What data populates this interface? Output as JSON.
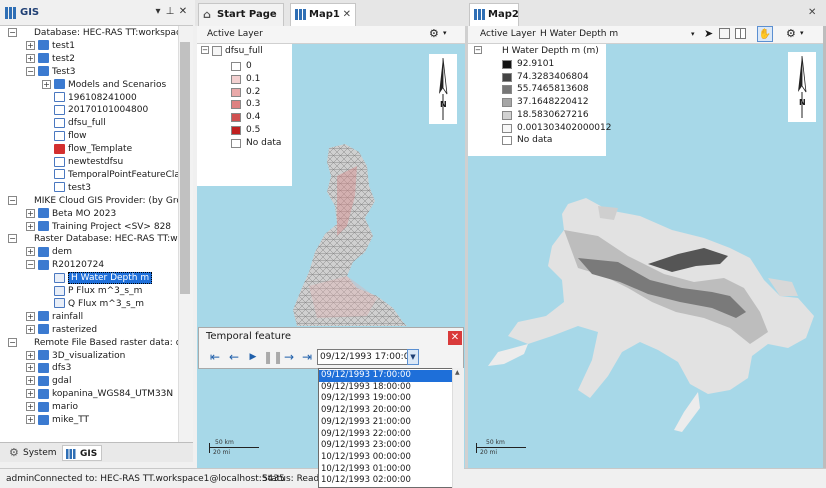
{
  "gis_panel": {
    "title": "GIS",
    "pin_icon": "pin-icon",
    "close_icon": "close-icon",
    "tree": [
      {
        "label": "Database: HEC-RAS TT:workspac•",
        "icon": "database",
        "level": 0,
        "expander": "-"
      },
      {
        "label": "test1",
        "icon": "folder",
        "level": 1,
        "expander": "+"
      },
      {
        "label": "test2",
        "icon": "folder",
        "level": 1,
        "expander": "+"
      },
      {
        "label": "Test3",
        "icon": "folder",
        "level": 1,
        "expander": "-"
      },
      {
        "label": "Models and Scenarios",
        "icon": "folder",
        "level": 2,
        "expander": "+"
      },
      {
        "label": "196108241000",
        "icon": "layer",
        "level": 2,
        "expander": ""
      },
      {
        "label": "20170101004800",
        "icon": "layer",
        "level": 2,
        "expander": ""
      },
      {
        "label": "dfsu_full",
        "icon": "layer",
        "level": 2,
        "expander": ""
      },
      {
        "label": "flow",
        "icon": "layer",
        "level": 2,
        "expander": ""
      },
      {
        "label": "flow_Template",
        "icon": "red",
        "level": 2,
        "expander": ""
      },
      {
        "label": "newtestdfsu",
        "icon": "layer",
        "level": 2,
        "expander": ""
      },
      {
        "label": "TemporalPointFeatureCla",
        "icon": "layer",
        "level": 2,
        "expander": ""
      },
      {
        "label": "test3",
        "icon": "layer",
        "level": 2,
        "expander": ""
      },
      {
        "label": "MIKE Cloud GIS Provider:  (by Gro",
        "icon": "database",
        "level": 0,
        "expander": "-"
      },
      {
        "label": "Beta MO 2023",
        "icon": "folder",
        "level": 1,
        "expander": "+"
      },
      {
        "label": "Training Project <SV> 828",
        "icon": "folder",
        "level": 1,
        "expander": "+"
      },
      {
        "label": "Raster Database: HEC-RAS TT:wo",
        "icon": "database",
        "level": 0,
        "expander": "-"
      },
      {
        "label": "dem",
        "icon": "folder",
        "level": 1,
        "expander": "+"
      },
      {
        "label": "R20120724",
        "icon": "folder",
        "level": 1,
        "expander": "-"
      },
      {
        "label": "H Water Depth m",
        "icon": "raster",
        "level": 2,
        "expander": "",
        "selected": true
      },
      {
        "label": "P Flux m^3_s_m",
        "icon": "raster",
        "level": 2,
        "expander": ""
      },
      {
        "label": "Q Flux m^3_s_m",
        "icon": "raster",
        "level": 2,
        "expander": ""
      },
      {
        "label": "rainfall",
        "icon": "folder",
        "level": 1,
        "expander": "+"
      },
      {
        "label": "rasterized",
        "icon": "folder",
        "level": 1,
        "expander": "+"
      },
      {
        "label": "Remote File Based raster data: d",
        "icon": "database",
        "level": 0,
        "expander": "-"
      },
      {
        "label": "3D_visualization",
        "icon": "folder",
        "level": 1,
        "expander": "+"
      },
      {
        "label": "dfs3",
        "icon": "folder",
        "level": 1,
        "expander": "+"
      },
      {
        "label": "gdal",
        "icon": "folder",
        "level": 1,
        "expander": "+"
      },
      {
        "label": "kopanina_WGS84_UTM33N",
        "icon": "folder",
        "level": 1,
        "expander": "+"
      },
      {
        "label": "mario",
        "icon": "folder",
        "level": 1,
        "expander": "+"
      },
      {
        "label": "mike_TT",
        "icon": "folder",
        "level": 1,
        "expander": "+"
      }
    ],
    "bottom_tabs": [
      {
        "label": "System",
        "icon": "gear-icon"
      },
      {
        "label": "GIS",
        "icon": "gis-icon"
      }
    ]
  },
  "status_bar": {
    "user": "admin",
    "connection": "Connected to: HEC-RAS TT.workspace1@localhost:5435",
    "status": "Status: Ready"
  },
  "tabs": {
    "start_page": "Start Page",
    "map1": "Map1",
    "map2": "Map2"
  },
  "map1": {
    "active_layer_label": "Active Layer",
    "legend_title": "dfsu_full",
    "legend_items": [
      {
        "label": "0",
        "color": "#ffffff"
      },
      {
        "label": "0.1",
        "color": "#f3d0d0"
      },
      {
        "label": "0.2",
        "color": "#e9a9a9"
      },
      {
        "label": "0.3",
        "color": "#de8282"
      },
      {
        "label": "0.4",
        "color": "#d05050"
      },
      {
        "label": "0.5",
        "color": "#c02020"
      },
      {
        "label": "No data",
        "color": "#ffffff"
      }
    ],
    "scale_top": "50 km",
    "scale_bottom": "20 mi"
  },
  "map2": {
    "active_layer_label": "Active Layer",
    "active_layer_value": "H Water Depth m",
    "legend_title": "H Water Depth m (m)",
    "legend_items": [
      {
        "label": "92.9101",
        "color": "#111111"
      },
      {
        "label": "74.3283406804",
        "color": "#444444"
      },
      {
        "label": "55.7465813608",
        "color": "#777777"
      },
      {
        "label": "37.1648220412",
        "color": "#a6a6a6"
      },
      {
        "label": "18.5830627216",
        "color": "#d2d2d2"
      },
      {
        "label": "0.001303402000012",
        "color": "#f7f7f7"
      },
      {
        "label": "No data",
        "color": "#ffffff"
      }
    ],
    "scale_top": "50 km",
    "scale_bottom": "20 mi"
  },
  "north_arrow_label": "N",
  "temporal": {
    "title": "Temporal feature",
    "selected_value": "09/12/1993 17:00:0",
    "options": [
      "09/12/1993 17:00:00",
      "09/12/1993 18:00:00",
      "09/12/1993 19:00:00",
      "09/12/1993 20:00:00",
      "09/12/1993 21:00:00",
      "09/12/1993 22:00:00",
      "09/12/1993 23:00:00",
      "10/12/1993 00:00:00",
      "10/12/1993 01:00:00",
      "10/12/1993 02:00:00"
    ]
  },
  "colors": {
    "water": "#a7d8e8",
    "accent": "#1e6fd9",
    "close_red": "#d93a3a"
  }
}
